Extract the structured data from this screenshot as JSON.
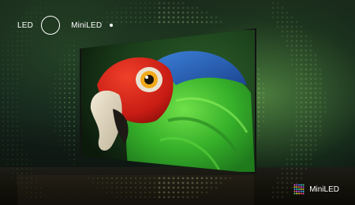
{
  "comparison": {
    "left_label": "LED",
    "right_label": "MiniLED"
  },
  "brand": {
    "label": "MiniLED"
  },
  "colors": {
    "ambient_glow": "#78c85a",
    "parrot_green": "#3fb52c",
    "parrot_red": "#d8261b",
    "parrot_blue": "#2a5fb0",
    "parrot_eye": "#f2a81a"
  },
  "icons": [
    "ring-icon",
    "dot-icon",
    "miniled-grid-logo-icon"
  ]
}
